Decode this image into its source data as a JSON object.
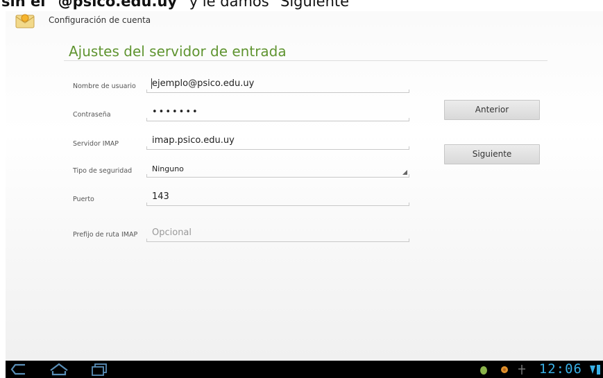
{
  "caption": {
    "prefix": "sin el ",
    "bold": "\"@psico.edu.uy\"",
    "suffix": " y le damos \"Siguiente\""
  },
  "app": {
    "title": "Configuración de cuenta"
  },
  "section": {
    "title": "Ajustes del servidor de entrada"
  },
  "form": {
    "username": {
      "label": "Nombre de usuario",
      "value": "ejemplo@psico.edu.uy"
    },
    "password": {
      "label": "Contraseña",
      "value": "•••••••"
    },
    "imap_server": {
      "label": "Servidor IMAP",
      "value": "imap.psico.edu.uy"
    },
    "security_type": {
      "label": "Tipo de seguridad",
      "value": "Ninguno"
    },
    "port": {
      "label": "Puerto",
      "value": "143"
    },
    "imap_path_prefix": {
      "label": "Prefijo de ruta IMAP",
      "placeholder": "Opcional",
      "value": ""
    }
  },
  "buttons": {
    "previous": "Anterior",
    "next": "Siguiente"
  },
  "statusbar": {
    "time": "12:06"
  },
  "colors": {
    "title_green": "#5f9430",
    "clock_blue": "#39b0e6"
  }
}
